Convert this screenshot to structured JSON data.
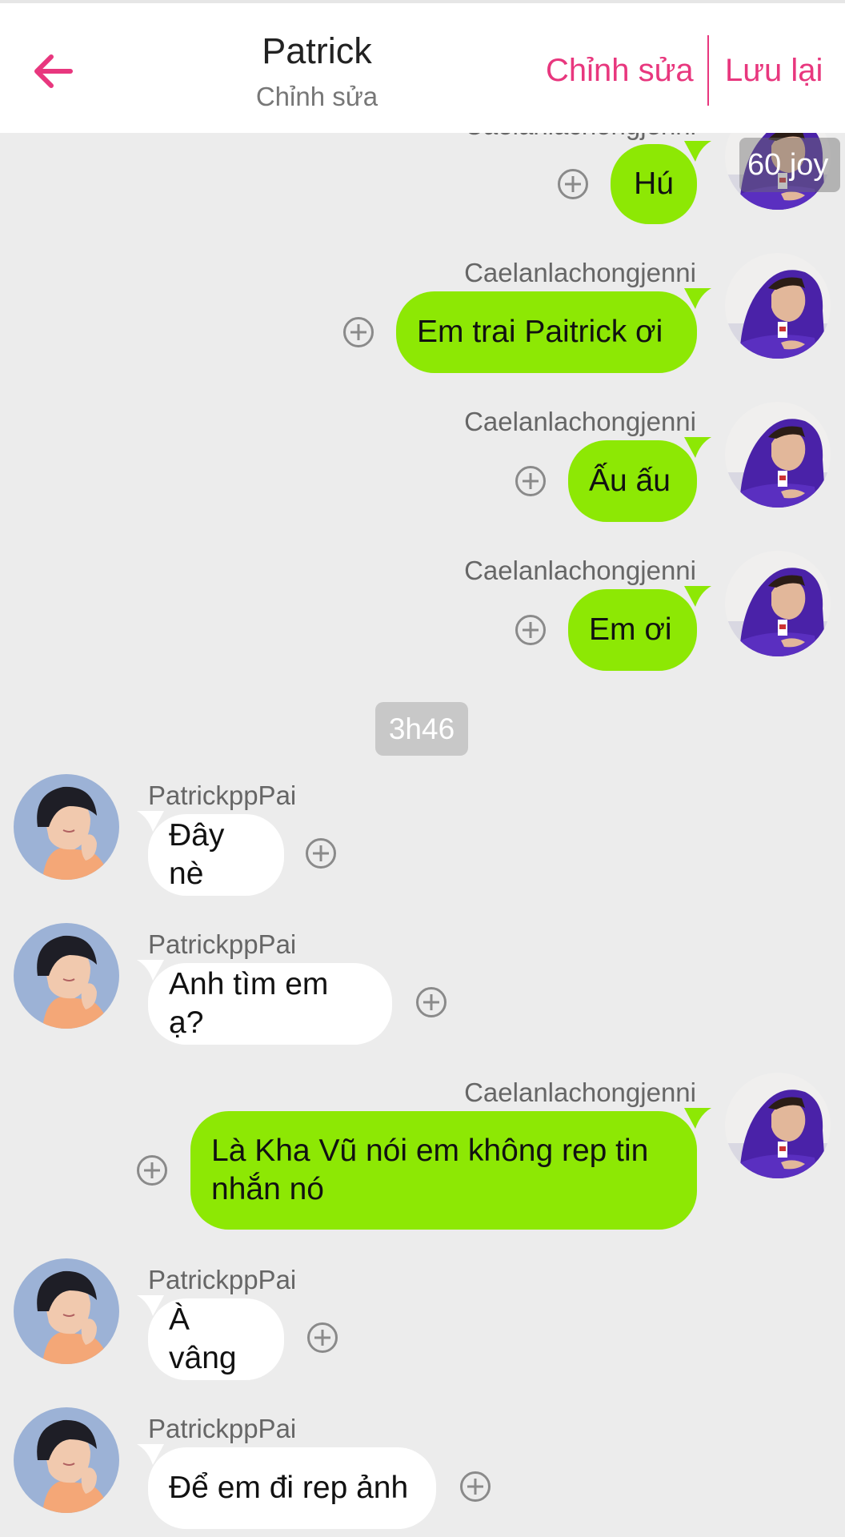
{
  "header": {
    "title": "Patrick",
    "subtitle": "Chỉnh sửa",
    "edit_label": "Chỉnh sửa",
    "save_label": "Lưu lại",
    "accent_color": "#e8377e"
  },
  "badges": {
    "joy": "60 joy",
    "time": "3h46"
  },
  "colors": {
    "green_bubble": "#8de804",
    "white_bubble": "#ffffff",
    "background": "#ececec"
  },
  "messages": [
    {
      "side": "right",
      "sender": "Caelanlachongjenni",
      "text": "Hú"
    },
    {
      "side": "right",
      "sender": "Caelanlachongjenni",
      "text": "Em trai Paitrick ơi"
    },
    {
      "side": "right",
      "sender": "Caelanlachongjenni",
      "text": "Ấu ấu"
    },
    {
      "side": "right",
      "sender": "Caelanlachongjenni",
      "text": "Em ơi"
    },
    {
      "side": "left",
      "sender": "PatrickppPai",
      "text": "Đây nè"
    },
    {
      "side": "left",
      "sender": "PatrickppPai",
      "text": "Anh tìm em ạ?"
    },
    {
      "side": "right",
      "sender": "Caelanlachongjenni",
      "text": "Là Kha Vũ nói em không rep tin nhắn nó"
    },
    {
      "side": "left",
      "sender": "PatrickppPai",
      "text": "À vâng"
    },
    {
      "side": "left",
      "sender": "PatrickppPai",
      "text": "Để em đi rep ảnh"
    }
  ]
}
